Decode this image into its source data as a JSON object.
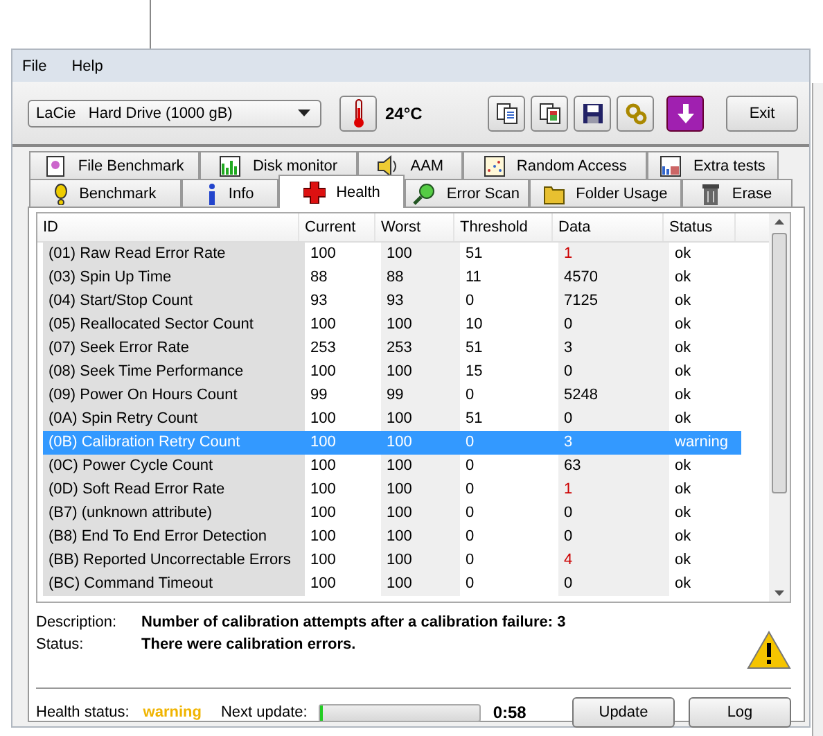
{
  "menu": [
    "File",
    "Help"
  ],
  "drive": {
    "value": "LaCie   Hard Drive (1000 gB)"
  },
  "temperature": "24°C",
  "exit_button": "Exit",
  "tabs_top": [
    {
      "label": "File Benchmark",
      "selected": false
    },
    {
      "label": "Disk monitor",
      "selected": false
    },
    {
      "label": "AAM",
      "selected": false
    },
    {
      "label": "Random Access",
      "selected": false
    },
    {
      "label": "Extra tests",
      "selected": false
    }
  ],
  "tabs_bottom": [
    {
      "label": "Benchmark",
      "selected": false
    },
    {
      "label": "Info",
      "selected": false
    },
    {
      "label": "Health",
      "selected": true
    },
    {
      "label": "Error Scan",
      "selected": false
    },
    {
      "label": "Folder Usage",
      "selected": false
    },
    {
      "label": "Erase",
      "selected": false
    }
  ],
  "table": {
    "columns": [
      "ID",
      "Current",
      "Worst",
      "Threshold",
      "Data",
      "Status"
    ],
    "rows": [
      {
        "cells": [
          "(01) Raw Read Error Rate",
          "100",
          "100",
          "51",
          "1",
          "ok"
        ],
        "selected": false,
        "data_highlight": true
      },
      {
        "cells": [
          "(03) Spin Up Time",
          "88",
          "88",
          "11",
          "4570",
          "ok"
        ],
        "selected": false,
        "data_highlight": false
      },
      {
        "cells": [
          "(04) Start/Stop Count",
          "93",
          "93",
          "0",
          "7125",
          "ok"
        ],
        "selected": false,
        "data_highlight": false
      },
      {
        "cells": [
          "(05) Reallocated Sector Count",
          "100",
          "100",
          "10",
          "0",
          "ok"
        ],
        "selected": false,
        "data_highlight": false
      },
      {
        "cells": [
          "(07) Seek Error Rate",
          "253",
          "253",
          "51",
          "3",
          "ok"
        ],
        "selected": false,
        "data_highlight": false
      },
      {
        "cells": [
          "(08) Seek Time Performance",
          "100",
          "100",
          "15",
          "0",
          "ok"
        ],
        "selected": false,
        "data_highlight": false
      },
      {
        "cells": [
          "(09) Power On Hours Count",
          "99",
          "99",
          "0",
          "5248",
          "ok"
        ],
        "selected": false,
        "data_highlight": false
      },
      {
        "cells": [
          "(0A) Spin Retry Count",
          "100",
          "100",
          "51",
          "0",
          "ok"
        ],
        "selected": false,
        "data_highlight": false
      },
      {
        "cells": [
          "(0B) Calibration Retry Count",
          "100",
          "100",
          "0",
          "3",
          "warning"
        ],
        "selected": true,
        "data_highlight": false
      },
      {
        "cells": [
          "(0C) Power Cycle Count",
          "100",
          "100",
          "0",
          "63",
          "ok"
        ],
        "selected": false,
        "data_highlight": false
      },
      {
        "cells": [
          "(0D) Soft Read Error Rate",
          "100",
          "100",
          "0",
          "1",
          "ok"
        ],
        "selected": false,
        "data_highlight": true
      },
      {
        "cells": [
          "(B7) (unknown attribute)",
          "100",
          "100",
          "0",
          "0",
          "ok"
        ],
        "selected": false,
        "data_highlight": false
      },
      {
        "cells": [
          "(B8) End To End Error Detection",
          "100",
          "100",
          "0",
          "0",
          "ok"
        ],
        "selected": false,
        "data_highlight": false
      },
      {
        "cells": [
          "(BB) Reported Uncorrectable Errors",
          "100",
          "100",
          "0",
          "4",
          "ok"
        ],
        "selected": false,
        "data_highlight": true
      },
      {
        "cells": [
          "(BC) Command Timeout",
          "100",
          "100",
          "0",
          "0",
          "ok"
        ],
        "selected": false,
        "data_highlight": false
      }
    ]
  },
  "description": {
    "label": "Description:",
    "text": "Number of calibration attempts after a calibration failure: 3"
  },
  "status": {
    "label": "Status:",
    "text": "There were calibration errors."
  },
  "health": {
    "label": "Health status:",
    "value": "warning"
  },
  "next_update": {
    "label": "Next update:",
    "level": 0.02,
    "time": "0:58"
  },
  "buttons": [
    "Update",
    "Log"
  ]
}
